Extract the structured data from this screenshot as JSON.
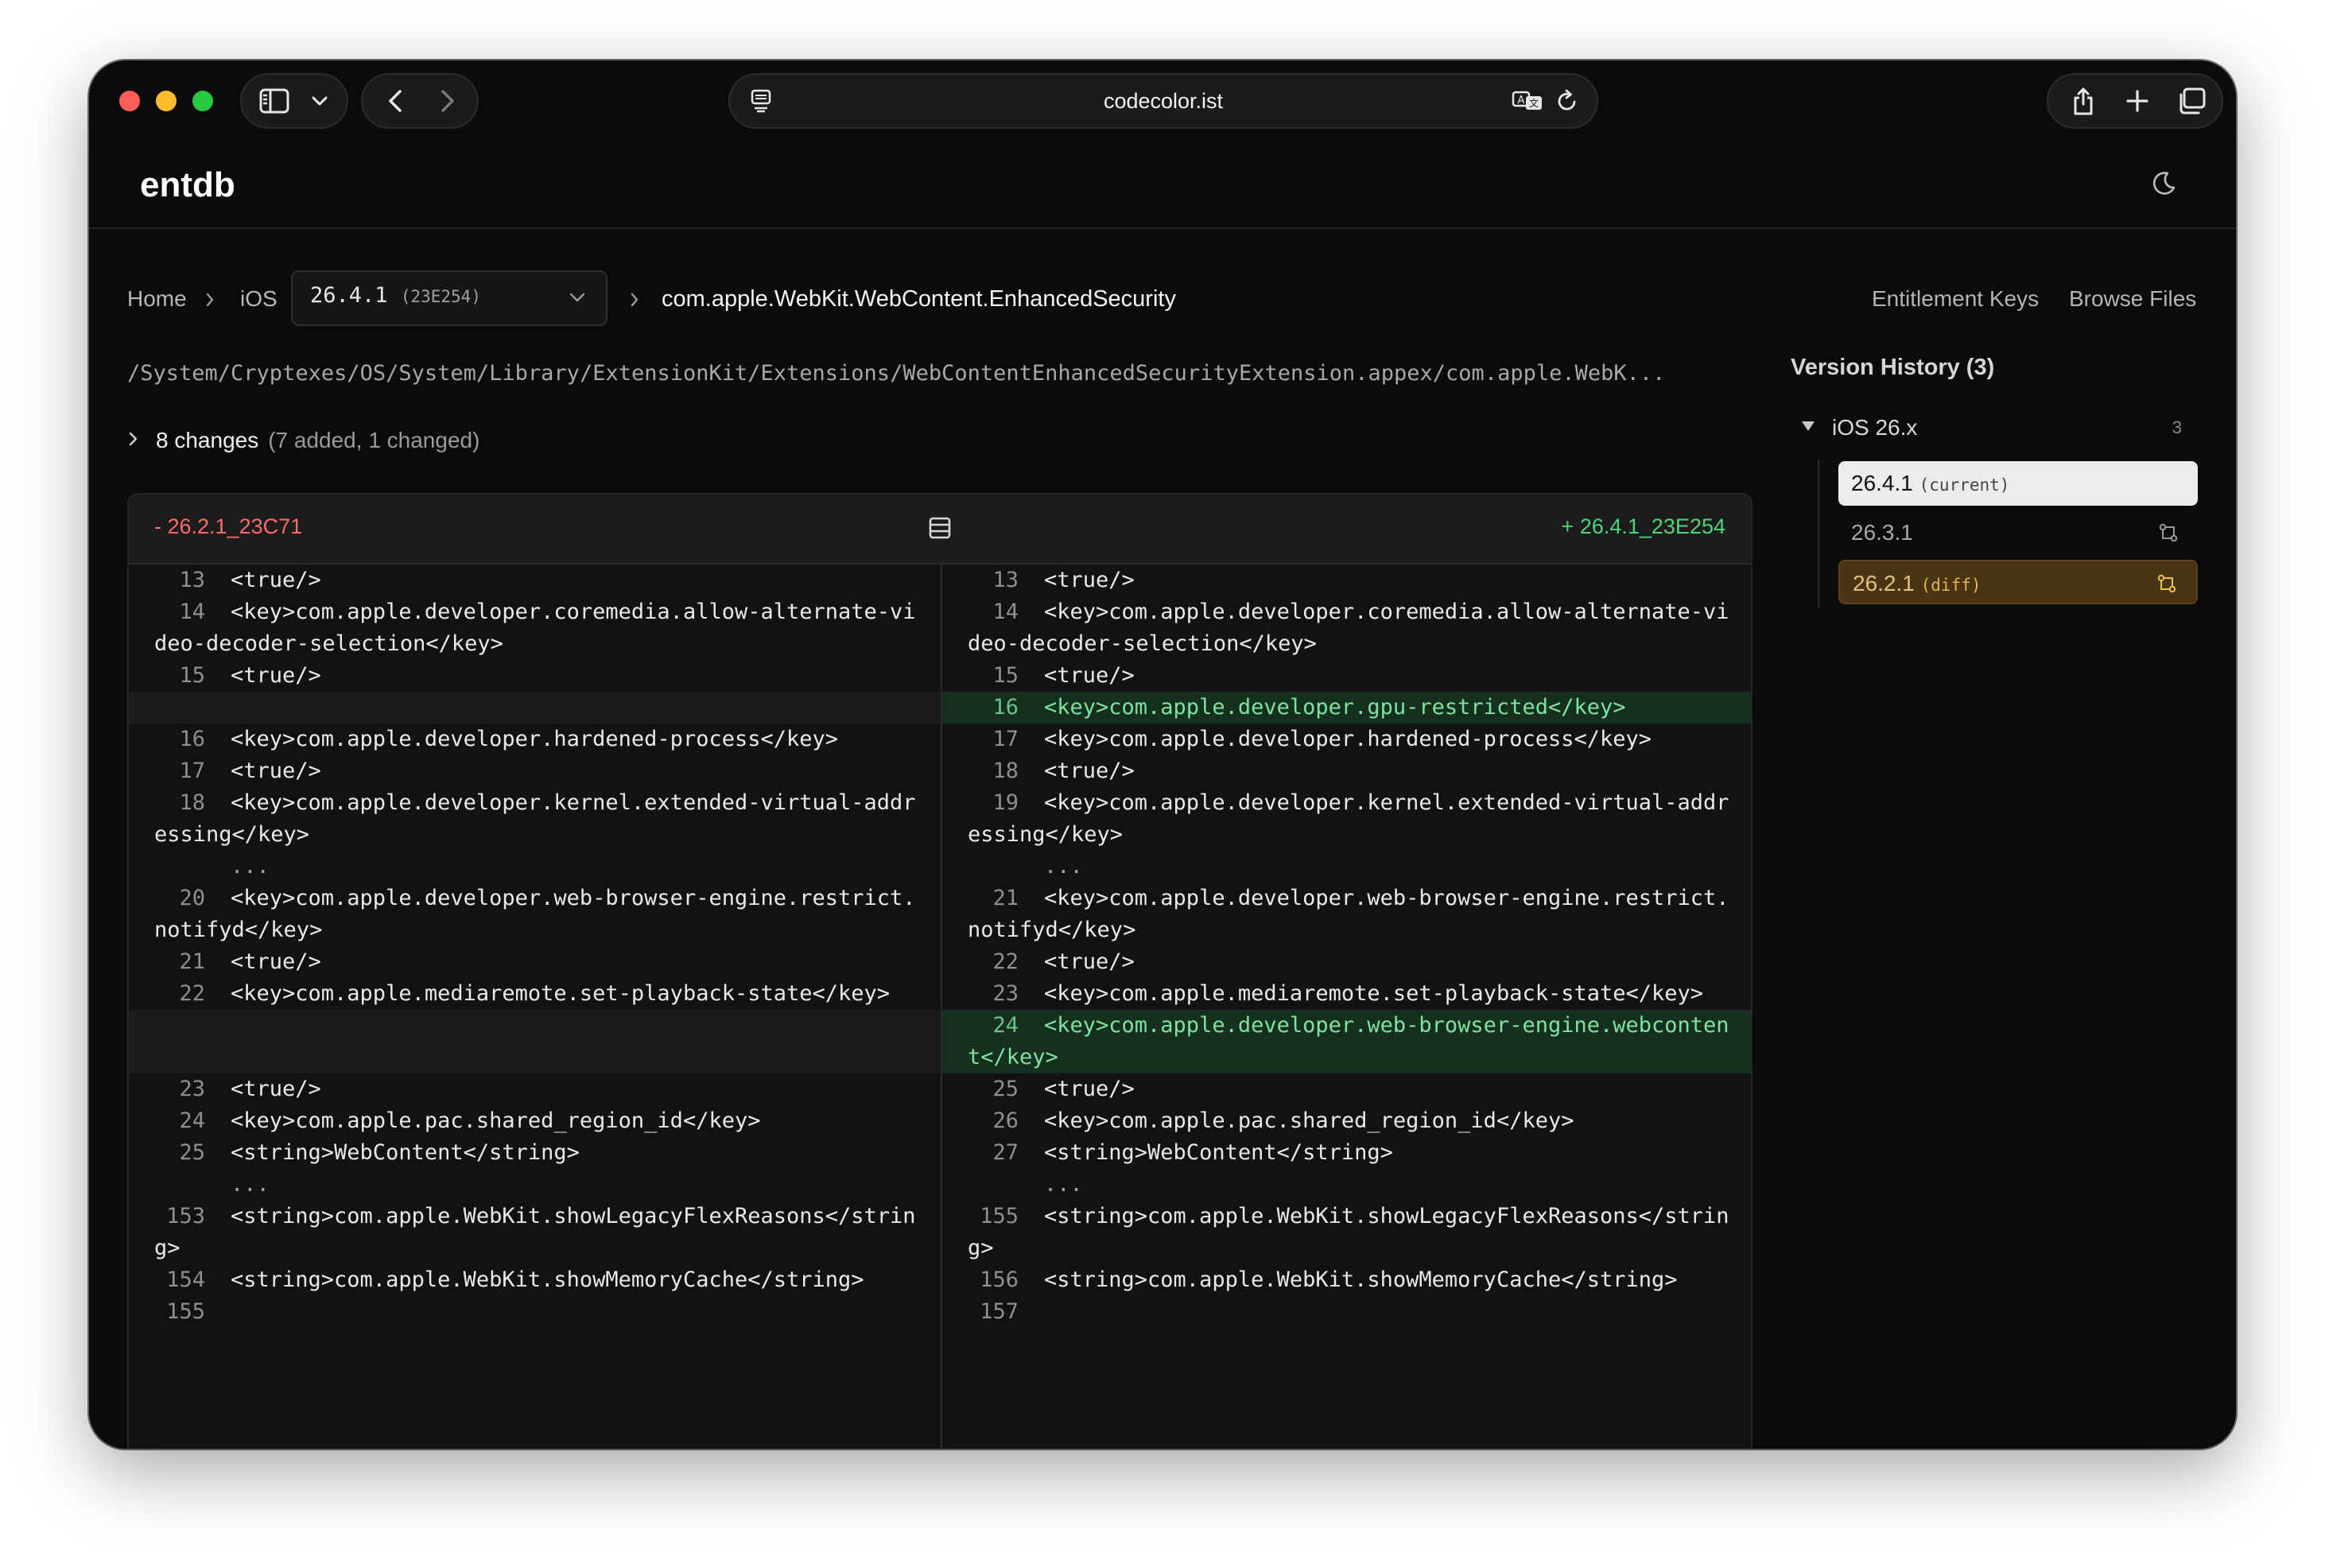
{
  "browser": {
    "address": "codecolor.ist"
  },
  "site": {
    "logo": "entdb"
  },
  "breadcrumb": {
    "home": "Home",
    "platform": "iOS",
    "version": "26.4.1",
    "build": "(23E254)",
    "current": "com.apple.WebKit.WebContent.EnhancedSecurity"
  },
  "top_links": {
    "entitlement_keys": "Entitlement Keys",
    "browse_files": "Browse Files"
  },
  "path": "/System/Cryptexes/OS/System/Library/ExtensionKit/Extensions/WebContentEnhancedSecurityExtension.appex/com.apple.WebK...",
  "changes": {
    "count_label": "8 changes",
    "detail": "(7 added, 1 changed)"
  },
  "diff": {
    "old_label": "- 26.2.1_23C71",
    "new_label": "+ 26.4.1_23E254",
    "rows": [
      {
        "left": {
          "ln": "13",
          "code": "<true/>"
        },
        "right": {
          "ln": "13",
          "code": "<true/>"
        }
      },
      {
        "left": {
          "ln": "14",
          "code": "<key>com.apple.developer.coremedia.allow-alternate-video-decoder-selection</key>"
        },
        "right": {
          "ln": "14",
          "code": "<key>com.apple.developer.coremedia.allow-alternate-video-decoder-selection</key>"
        }
      },
      {
        "left": {
          "ln": "15",
          "code": "<true/>"
        },
        "right": {
          "ln": "15",
          "code": "<true/>"
        }
      },
      {
        "left": {
          "ln": "",
          "code": ""
        },
        "right": {
          "ln": "16",
          "code": "<key>com.apple.developer.gpu-restricted</key>"
        }
      },
      {
        "left": {
          "ln": "16",
          "code": "<key>com.apple.developer.hardened-process</key>"
        },
        "right": {
          "ln": "17",
          "code": "<key>com.apple.developer.hardened-process</key>"
        }
      },
      {
        "left": {
          "ln": "17",
          "code": "<true/>"
        },
        "right": {
          "ln": "18",
          "code": "<true/>"
        }
      },
      {
        "left": {
          "ln": "18",
          "code": "<key>com.apple.developer.kernel.extended-virtual-addressing</key>"
        },
        "right": {
          "ln": "19",
          "code": "<key>com.apple.developer.kernel.extended-virtual-addressing</key>"
        }
      },
      {
        "left": {
          "ln": "",
          "code": "..."
        },
        "right": {
          "ln": "",
          "code": "..."
        }
      },
      {
        "left": {
          "ln": "20",
          "code": "<key>com.apple.developer.web-browser-engine.restrict.notifyd</key>"
        },
        "right": {
          "ln": "21",
          "code": "<key>com.apple.developer.web-browser-engine.restrict.notifyd</key>"
        }
      },
      {
        "left": {
          "ln": "21",
          "code": "<true/>"
        },
        "right": {
          "ln": "22",
          "code": "<true/>"
        }
      },
      {
        "left": {
          "ln": "22",
          "code": "<key>com.apple.mediaremote.set-playback-state</key>"
        },
        "right": {
          "ln": "23",
          "code": "<key>com.apple.mediaremote.set-playback-state</key>"
        }
      },
      {
        "left": {
          "ln": "",
          "code": ""
        },
        "right": {
          "ln": "24",
          "code": "<key>com.apple.developer.web-browser-engine.webcontent</key>"
        }
      },
      {
        "left": {
          "ln": "23",
          "code": "<true/>"
        },
        "right": {
          "ln": "25",
          "code": "<true/>"
        }
      },
      {
        "left": {
          "ln": "24",
          "code": "<key>com.apple.pac.shared_region_id</key>"
        },
        "right": {
          "ln": "26",
          "code": "<key>com.apple.pac.shared_region_id</key>"
        }
      },
      {
        "left": {
          "ln": "25",
          "code": "<string>WebContent</string>"
        },
        "right": {
          "ln": "27",
          "code": "<string>WebContent</string>"
        }
      },
      {
        "left": {
          "ln": "",
          "code": "..."
        },
        "right": {
          "ln": "",
          "code": "..."
        }
      },
      {
        "left": {
          "ln": "153",
          "code": "<string>com.apple.WebKit.showLegacyFlexReasons</string>"
        },
        "right": {
          "ln": "155",
          "code": "<string>com.apple.WebKit.showLegacyFlexReasons</string>"
        }
      },
      {
        "left": {
          "ln": "154",
          "code": "<string>com.apple.WebKit.showMemoryCache</string>"
        },
        "right": {
          "ln": "156",
          "code": "<string>com.apple.WebKit.showMemoryCache</string>"
        }
      },
      {
        "left": {
          "ln": "155",
          "code": ""
        },
        "right": {
          "ln": "157",
          "code": ""
        }
      }
    ]
  },
  "version_history": {
    "title": "Version History (3)",
    "group": {
      "label": "iOS 26.x",
      "count": "3"
    },
    "items": [
      {
        "version": "26.4.1",
        "tag": "(current)"
      },
      {
        "version": "26.3.1",
        "tag": ""
      },
      {
        "version": "26.2.1",
        "tag": "(diff)"
      }
    ]
  },
  "colors": {
    "removed": "#ff6b6b",
    "added": "#4fd67a",
    "added_row_bg": "#16301f",
    "diff_selected_bg": "#4a3416"
  },
  "icons": [
    "sidebar-icon",
    "chevron-down-icon",
    "back-icon",
    "forward-icon",
    "page-menu-icon",
    "translate-icon",
    "reload-icon",
    "share-icon",
    "new-tab-icon",
    "tabs-overview-icon",
    "moon-icon",
    "chevron-right-icon",
    "split-view-icon",
    "disclosure-triangle-icon",
    "compare-icon"
  ]
}
